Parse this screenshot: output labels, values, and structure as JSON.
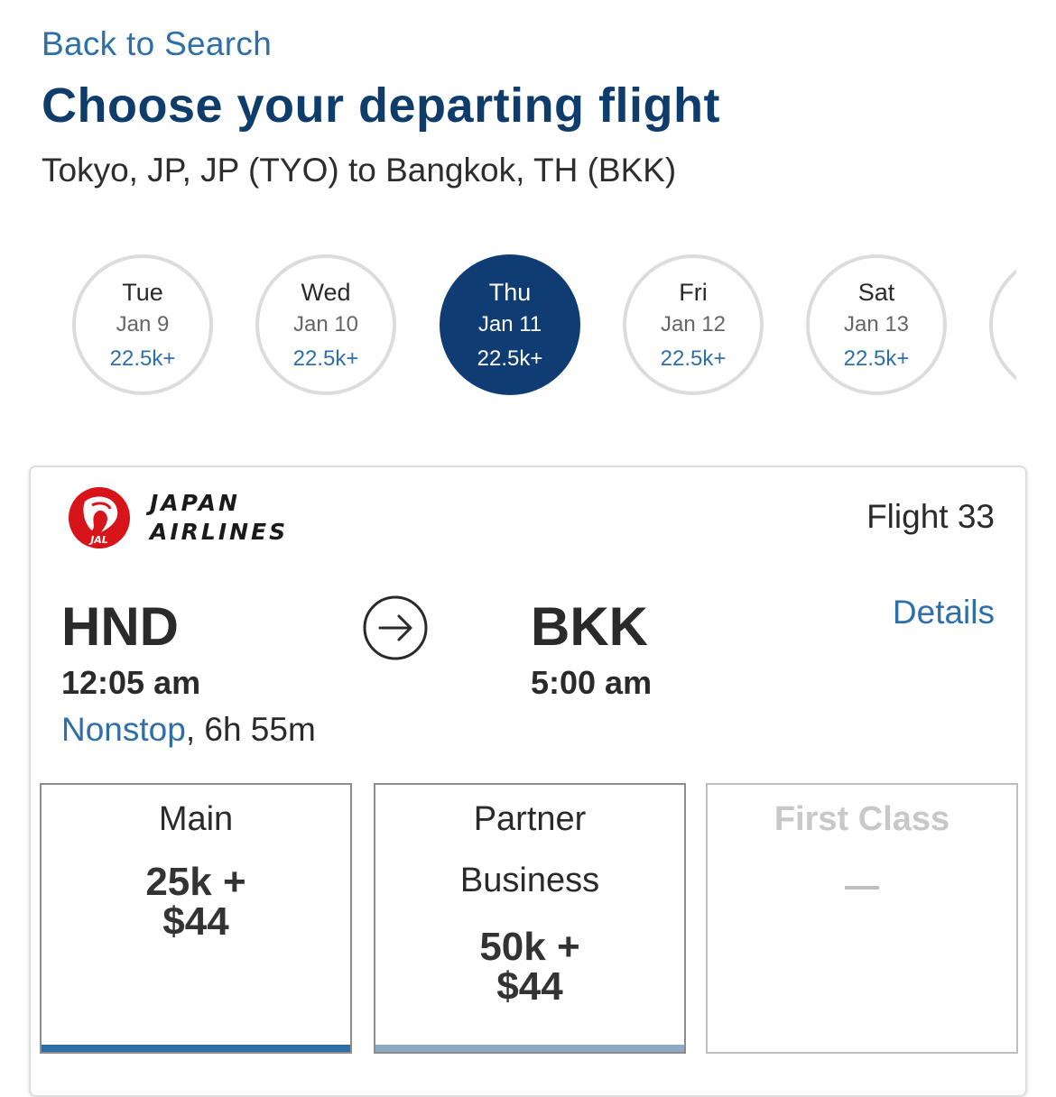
{
  "header": {
    "back_link": "Back to Search",
    "title": "Choose your departing flight",
    "route": "Tokyo, JP, JP (TYO) to Bangkok, TH (BKK)"
  },
  "dates": [
    {
      "dow": "Tue",
      "date": "Jan 9",
      "price": "22.5k+",
      "selected": false
    },
    {
      "dow": "Wed",
      "date": "Jan 10",
      "price": "22.5k+",
      "selected": false
    },
    {
      "dow": "Thu",
      "date": "Jan 11",
      "price": "22.5k+",
      "selected": true
    },
    {
      "dow": "Fri",
      "date": "Jan 12",
      "price": "22.5k+",
      "selected": false
    },
    {
      "dow": "Sat",
      "date": "Jan 13",
      "price": "22.5k+",
      "selected": false
    }
  ],
  "flight": {
    "airline_line1": "JAPAN",
    "airline_line2": "AIRLINES",
    "logo_text": "JAL",
    "flight_number": "Flight 33",
    "details_label": "Details",
    "origin": "HND",
    "destination": "BKK",
    "depart_time": "12:05 am",
    "arrive_time": "5:00 am",
    "stops": "Nonstop",
    "duration": ", 6h 55m"
  },
  "fares": [
    {
      "name": "Main",
      "price_line1": "25k +",
      "price_line2": "$44",
      "available": true
    },
    {
      "name_line1": "Partner",
      "name_line2": "Business",
      "price_line1": "50k +",
      "price_line2": "$44",
      "available": true
    },
    {
      "name": "First Class",
      "available": false
    }
  ],
  "colors": {
    "accent": "#2f6fa8",
    "title": "#0e3c6b",
    "selected_date": "#0e3c73",
    "jal_red": "#d7141a",
    "main_bar": "#2e6ea6",
    "business_bar": "#8da9c4"
  }
}
